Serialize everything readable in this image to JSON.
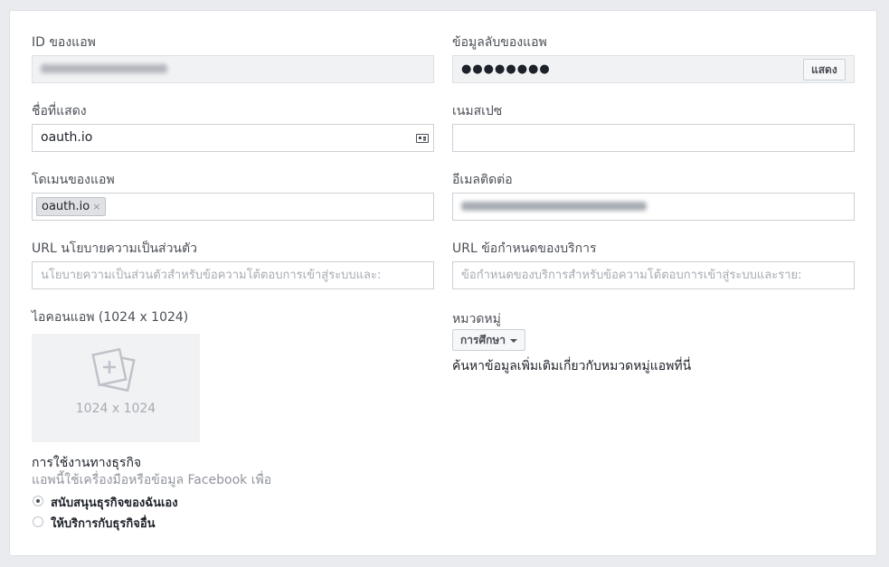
{
  "app_id": {
    "label": "ID ของแอพ"
  },
  "app_secret": {
    "label": "ข้อมูลลับของแอพ",
    "value": "●●●●●●●●",
    "show_button": "แสดง"
  },
  "display_name": {
    "label": "ชื่อที่แสดง",
    "value": "oauth.io"
  },
  "namespace": {
    "label": "เนมสเปซ",
    "value": ""
  },
  "app_domains": {
    "label": "โดเมนของแอพ",
    "token": "oauth.io",
    "remove": "×"
  },
  "contact_email": {
    "label": "อีเมลติดต่อ"
  },
  "privacy_url": {
    "label": "URL นโยบายความเป็นส่วนตัว",
    "placeholder": "นโยบายความเป็นส่วนตัวสำหรับข้อความโต้ตอบการเข้าสู่ระบบและ:"
  },
  "terms_url": {
    "label": "URL ข้อกำหนดของบริการ",
    "placeholder": "ข้อกำหนดของบริการสำหรับข้อความโต้ตอบการเข้าสู่ระบบและราย:"
  },
  "app_icon": {
    "label": "ไอคอนแอพ (1024 x 1024)",
    "caption": "1024 x 1024"
  },
  "category": {
    "label": "หมวดหมู่",
    "selected": "การศึกษา",
    "help": "ค้นหาข้อมูลเพิ่มเติมเกี่ยวกับหมวดหมู่แอพที่นี่"
  },
  "business_use": {
    "label": "การใช้งานทางธุรกิจ",
    "description": "แอพนี้ใช้เครื่องมือหรือข้อมูล Facebook เพื่อ",
    "options": [
      {
        "label": "สนับสนุนธุรกิจของฉันเอง",
        "selected": true
      },
      {
        "label": "ให้บริการกับธุรกิจอื่น",
        "selected": false
      }
    ]
  }
}
